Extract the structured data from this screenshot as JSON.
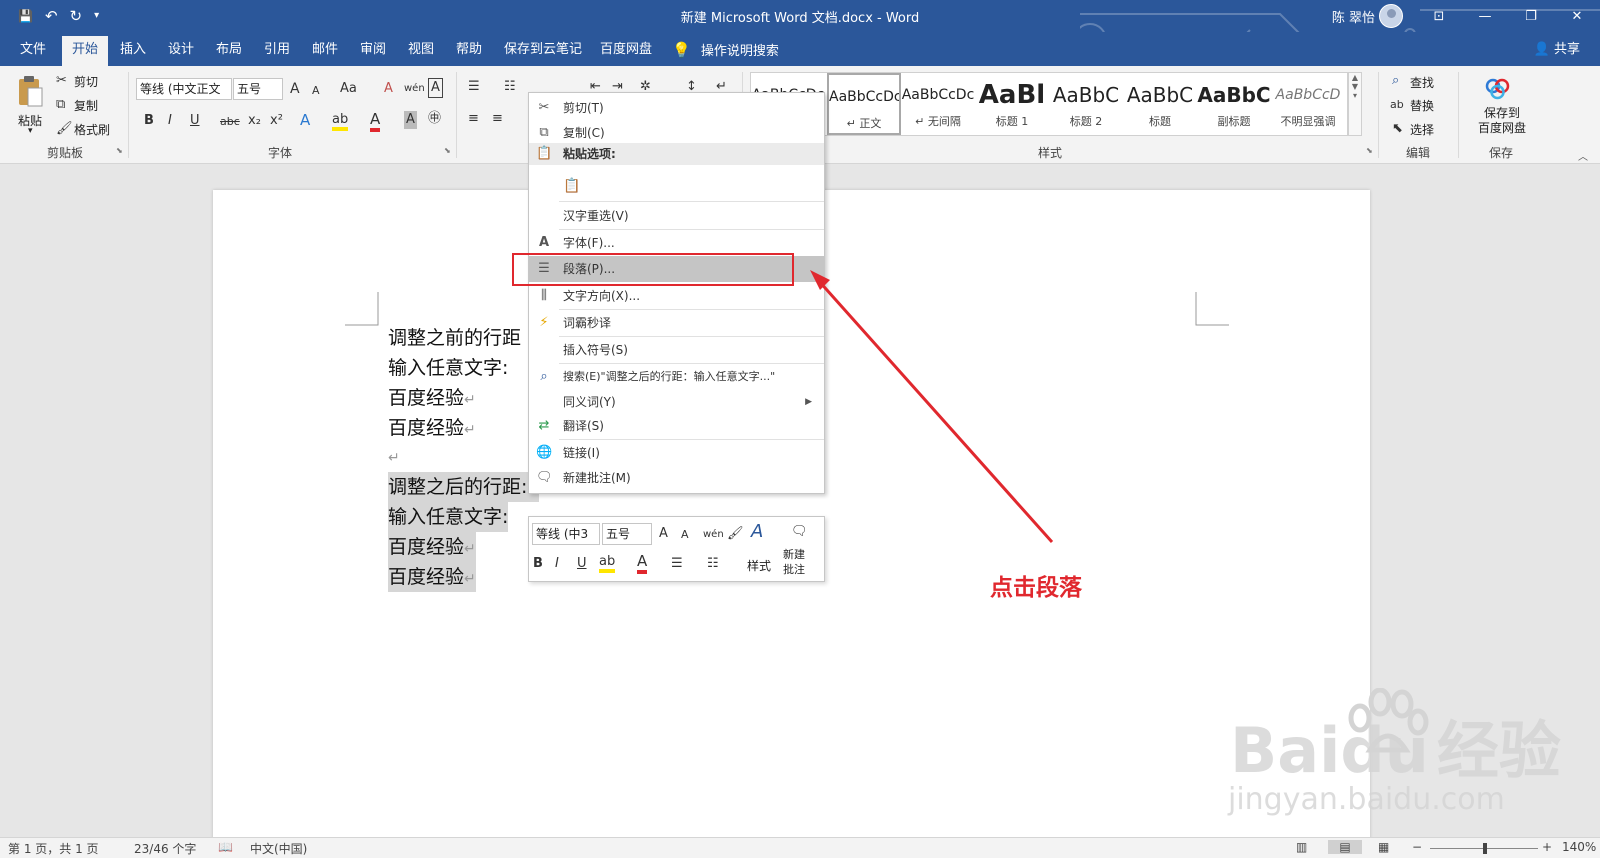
{
  "window": {
    "title": "新建 Microsoft Word 文档.docx  -  Word",
    "user": "陈 翠怡",
    "minimize": "—",
    "restore": "❐",
    "close": "✕",
    "ribbon_display": "⊡"
  },
  "qat": {
    "save": "💾",
    "undo": "↶",
    "redo": "↻",
    "customize": "▾"
  },
  "tabs": [
    "文件",
    "开始",
    "插入",
    "设计",
    "布局",
    "引用",
    "邮件",
    "审阅",
    "视图",
    "帮助",
    "保存到云笔记",
    "百度网盘"
  ],
  "active_tab": "开始",
  "tell_me": "操作说明搜索",
  "share": "共享",
  "ribbon": {
    "clipboard": {
      "paste": "粘贴",
      "cut": "剪切",
      "copy": "复制",
      "format_painter": "格式刷",
      "label": "剪贴板"
    },
    "font": {
      "family": "等线 (中文正文",
      "size": "五号",
      "label": "字体",
      "grow": "A",
      "shrink": "A",
      "case": "Aa",
      "bold": "B",
      "italic": "I",
      "underline": "U",
      "strike": "abc",
      "sub": "x₂",
      "sup": "x²",
      "clear": "A",
      "phonetic": "wén",
      "charborder": "A"
    },
    "paragraph": {
      "label": "段落"
    },
    "styles": {
      "label": "样式",
      "items": [
        {
          "preview": "AaBbCcDc",
          "name": ""
        },
        {
          "preview": "AaBbCcDc",
          "name": "↵ 正文"
        },
        {
          "preview": "AaBbCcDc",
          "name": "↵ 无间隔"
        },
        {
          "preview": "AaBl",
          "name": "标题 1"
        },
        {
          "preview": "AaBbC",
          "name": "标题 2"
        },
        {
          "preview": "AaBbC",
          "name": "标题"
        },
        {
          "preview": "AaBbC",
          "name": "副标题"
        },
        {
          "preview": "AaBbCcD",
          "name": "不明显强调"
        }
      ]
    },
    "editing": {
      "find": "查找",
      "replace": "替换",
      "select": "选择",
      "label": "编辑"
    },
    "save": {
      "button": "保存到\n百度网盘",
      "line1": "保存到",
      "line2": "百度网盘",
      "label": "保存"
    }
  },
  "document": {
    "lines": [
      {
        "text": "调整之前的行距",
        "mark": ""
      },
      {
        "text": "输入任意文字:",
        "mark": ""
      },
      {
        "text": "百度经验",
        "mark": "↵"
      },
      {
        "text": "百度经验",
        "mark": "↵"
      },
      {
        "text": "",
        "mark": "↵"
      },
      {
        "text": "调整之后的行距:",
        "mark": "↵"
      },
      {
        "text": "输入任意文字:",
        "mark": ""
      },
      {
        "text": "百度经验",
        "mark": "↵"
      },
      {
        "text": "百度经验",
        "mark": "↵"
      }
    ]
  },
  "context_menu": {
    "cut": "剪切(T)",
    "copy": "复制(C)",
    "paste_options": "粘贴选项:",
    "reconvert": "汉字重选(V)",
    "font": "字体(F)...",
    "paragraph": "段落(P)...",
    "text_direction": "文字方向(X)...",
    "translate_word": "词霸秒译",
    "insert_symbol": "插入符号(S)",
    "search": "搜索(E)\"调整之后的行距：输入任意文字...\"",
    "synonyms": "同义词(Y)",
    "translate": "翻译(S)",
    "link": "链接(I)",
    "new_comment": "新建批注(M)"
  },
  "mini_toolbar": {
    "font": "等线 (中3",
    "size": "五号",
    "styles": "样式",
    "new_comment_1": "新建",
    "new_comment_2": "批注",
    "bold": "B",
    "italic": "I",
    "underline": "U"
  },
  "annotation": {
    "text": "点击段落",
    "color": "#e0282e"
  },
  "watermark": {
    "brand": "Bai",
    "brand2": "du",
    "suffix": "经验",
    "url": "jingyan.baidu.com"
  },
  "status": {
    "page": "第 1 页，共 1 页",
    "words": "23/46 个字",
    "language": "中文(中国)",
    "zoom": "140%",
    "zoom_minus": "−",
    "zoom_plus": "+"
  },
  "colors": {
    "accent": "#2b579a",
    "annotation": "#e0282e",
    "highlight": "#d6d6d6"
  }
}
